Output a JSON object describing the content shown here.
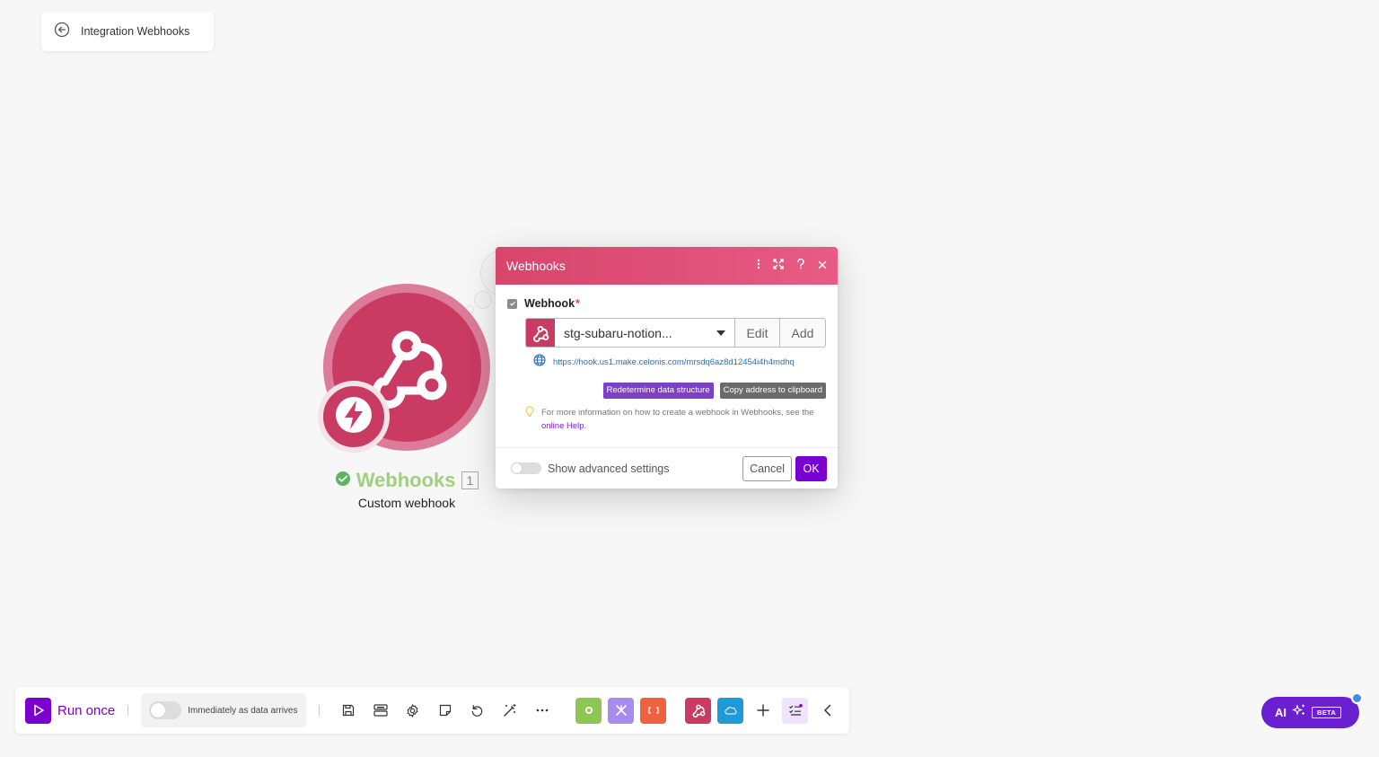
{
  "back": {
    "label": "Integration Webhooks"
  },
  "module": {
    "name": "Webhooks",
    "count": "1",
    "subtitle": "Custom webhook",
    "colors": {
      "main": "#c93b63",
      "ring": "#dc7c98",
      "status": "#9fd07e"
    }
  },
  "dialog": {
    "title": "Webhooks",
    "field_label": "Webhook",
    "required_mark": "*",
    "selected_value": "stg-subaru-notion...",
    "edit_label": "Edit",
    "add_label": "Add",
    "url": "https://hook.us1.make.celonis.com/mrsdq6az8d12454i4h4mdhq",
    "redetermine_label": "Redetermine data structure",
    "copy_label": "Copy address to clipboard",
    "hint_text": "For more information on how to create a webhook in Webhooks, see the",
    "hint_link": "online Help",
    "hint_end": ".",
    "advanced_label": "Show advanced settings",
    "cancel_label": "Cancel",
    "ok_label": "OK"
  },
  "toolbar": {
    "run_label": "Run once",
    "schedule_label": "Immediately as data arrives",
    "icons": [
      "save-icon",
      "autoalign-icon",
      "settings-icon",
      "notes-icon",
      "undo-icon",
      "magic-wand-icon",
      "more-icon"
    ],
    "apps": [
      {
        "name": "tools-app-icon",
        "color": "#8dc653"
      },
      {
        "name": "flow-control-app-icon",
        "color": "#a98bf0"
      },
      {
        "name": "text-parser-app-icon",
        "color": "#f0613f"
      },
      {
        "name": "webhooks-app-icon",
        "color": "#c93b63"
      },
      {
        "name": "salesforce-app-icon",
        "color": "#1f9ad6"
      }
    ]
  },
  "ai": {
    "label": "AI",
    "badge": "BETA"
  }
}
